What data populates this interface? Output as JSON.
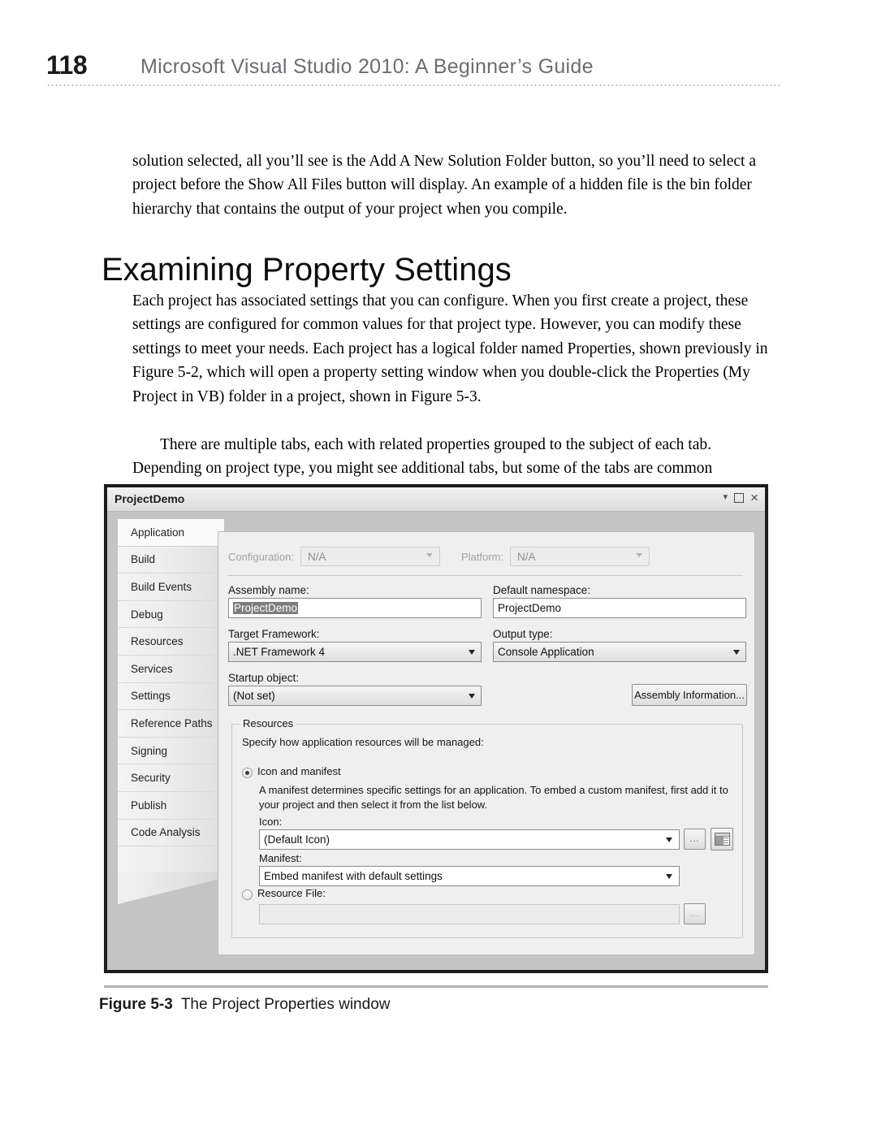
{
  "header": {
    "folio": "118",
    "running_title": "Microsoft Visual Studio 2010: A Beginner’s Guide"
  },
  "body": {
    "para_intro": "solution selected, all you’ll see is the Add A New Solution Folder button, so you’ll need to select a project before the Show All Files button will display. An example of a hidden file is the bin folder hierarchy that contains the output of your project when you compile.",
    "section_heading": "Examining Property Settings",
    "para_body1": "Each project has associated settings that you can configure. When you first create a project, these settings are configured for common values for that project type. However, you can modify these settings to meet your needs. Each project has a logical folder named Properties, shown previously in Figure 5-2, which will open a property setting window when you double-click the Properties (My Project in VB) folder in a project, shown in Figure 5-3.",
    "para_body2": "There are multiple tabs, each with related properties grouped to the subject of each tab. Depending on project type, you might see additional tabs, but some of the tabs are common"
  },
  "figure": {
    "caption_label": "Figure 5-3",
    "caption_text": "The Project Properties window",
    "window": {
      "title": "ProjectDemo",
      "buttons": {
        "caret": "▾",
        "close": "×"
      },
      "tabs": [
        {
          "label": "Application",
          "selected": true
        },
        {
          "label": "Build",
          "selected": false
        },
        {
          "label": "Build Events",
          "selected": false
        },
        {
          "label": "Debug",
          "selected": false
        },
        {
          "label": "Resources",
          "selected": false
        },
        {
          "label": "Services",
          "selected": false
        },
        {
          "label": "Settings",
          "selected": false
        },
        {
          "label": "Reference Paths",
          "selected": false
        },
        {
          "label": "Signing",
          "selected": false
        },
        {
          "label": "Security",
          "selected": false
        },
        {
          "label": "Publish",
          "selected": false
        },
        {
          "label": "Code Analysis",
          "selected": false
        }
      ],
      "application_pane": {
        "configuration_label": "Configuration:",
        "configuration_value": "N/A",
        "platform_label": "Platform:",
        "platform_value": "N/A",
        "assembly_name_label": "Assembly name:",
        "assembly_name_value": "ProjectDemo",
        "default_namespace_label": "Default namespace:",
        "default_namespace_value": "ProjectDemo",
        "target_framework_label": "Target Framework:",
        "target_framework_value": ".NET Framework 4",
        "output_type_label": "Output type:",
        "output_type_value": "Console Application",
        "startup_object_label": "Startup object:",
        "startup_object_value": "(Not set)",
        "assembly_information_button": "Assembly Information...",
        "resources_group": {
          "legend": "Resources",
          "specify_text": "Specify how application resources will be managed:",
          "icon_and_manifest_label": "Icon and manifest",
          "icon_and_manifest_selected": true,
          "manifest_description": "A manifest determines specific settings for an application. To embed a custom manifest, first add it to your project and then select it from the list below.",
          "icon_label": "Icon:",
          "icon_value": "(Default Icon)",
          "icon_browse_button": "...",
          "manifest_label": "Manifest:",
          "manifest_value": "Embed manifest with default settings",
          "resource_file_label": "Resource File:",
          "resource_file_selected": false,
          "resource_file_value": "",
          "resource_file_browse_button": "..."
        }
      }
    }
  }
}
